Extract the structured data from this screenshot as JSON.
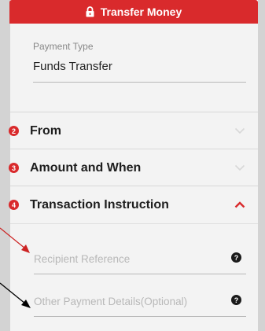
{
  "header": {
    "title": "Transfer Money",
    "icon": "lock-icon",
    "color": "#d92a2c"
  },
  "payment_type": {
    "label": "Payment Type",
    "value": "Funds Transfer"
  },
  "sections": [
    {
      "number": "2",
      "title": "From",
      "state": "collapsed"
    },
    {
      "number": "3",
      "title": "Amount and When",
      "state": "collapsed"
    },
    {
      "number": "4",
      "title": "Transaction Instruction",
      "state": "expanded"
    }
  ],
  "instruction": {
    "recipient_reference": {
      "placeholder": "Recipient Reference",
      "help": "?"
    },
    "other_payment_details": {
      "placeholder": "Other Payment Details(Optional)",
      "help": "?"
    }
  },
  "colors": {
    "accent": "#d92a2c",
    "chevron_collapsed": "#d8d8d8",
    "bezel": "#d3d3d3"
  }
}
